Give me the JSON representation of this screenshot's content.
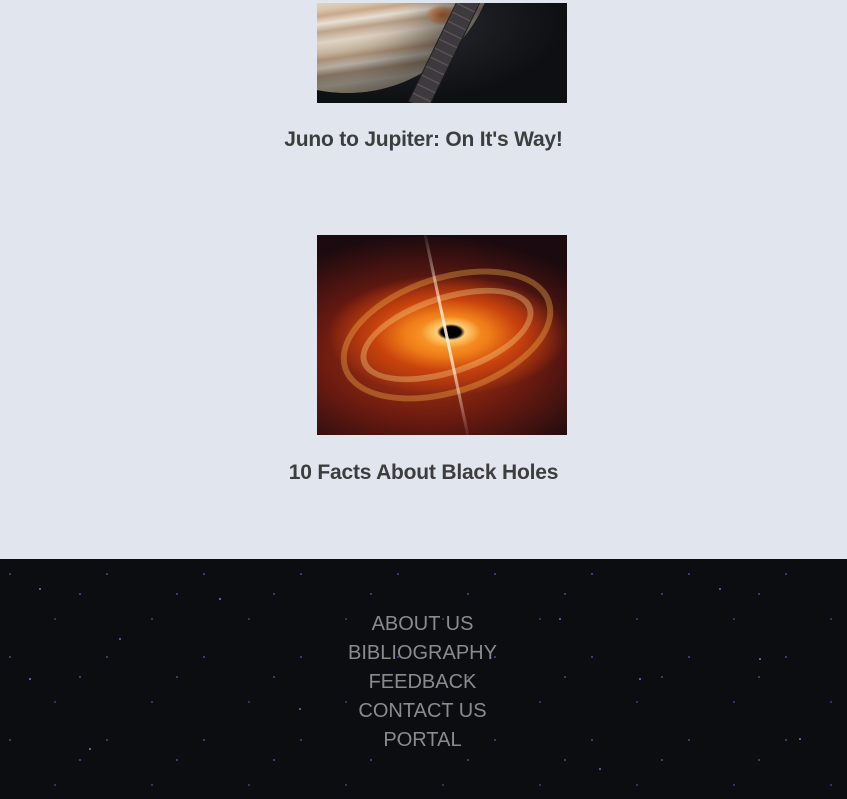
{
  "articles": [
    {
      "title": "Juno to Jupiter: On It's Way!",
      "image": "juno-jupiter-image"
    },
    {
      "title": "10 Facts About Black Holes",
      "image": "black-hole-image"
    }
  ],
  "footer": {
    "links": [
      "ABOUT US",
      "BIBLIOGRAPHY",
      "FEEDBACK",
      "CONTACT US",
      "PORTAL"
    ]
  },
  "colors": {
    "content_background": "#e1e6ee",
    "title_text": "#3d3d3d",
    "footer_background": "#0c0d10",
    "footer_link": "#8a8a8f"
  }
}
